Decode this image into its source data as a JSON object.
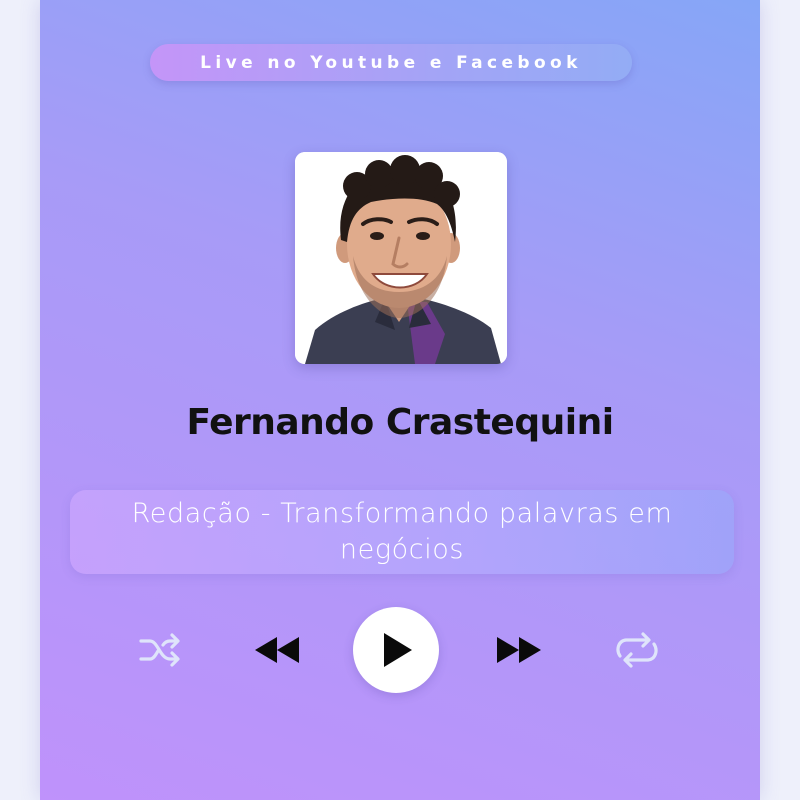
{
  "header": {
    "badge_text": "Live no Youtube e Facebook"
  },
  "profile": {
    "photo": "presenter-photo",
    "name": "Fernando Crastequini"
  },
  "session": {
    "title": "Redação - Transformando palavras em negócios"
  },
  "player": {
    "controls": [
      "shuffle-icon",
      "rewind-icon",
      "play-icon",
      "fast-forward-icon",
      "repeat-icon"
    ]
  },
  "colors": {
    "gradient_top": "#86a6f7",
    "gradient_bottom": "#bf92fb",
    "text_dark": "#111111",
    "text_light": "#ffffff"
  }
}
